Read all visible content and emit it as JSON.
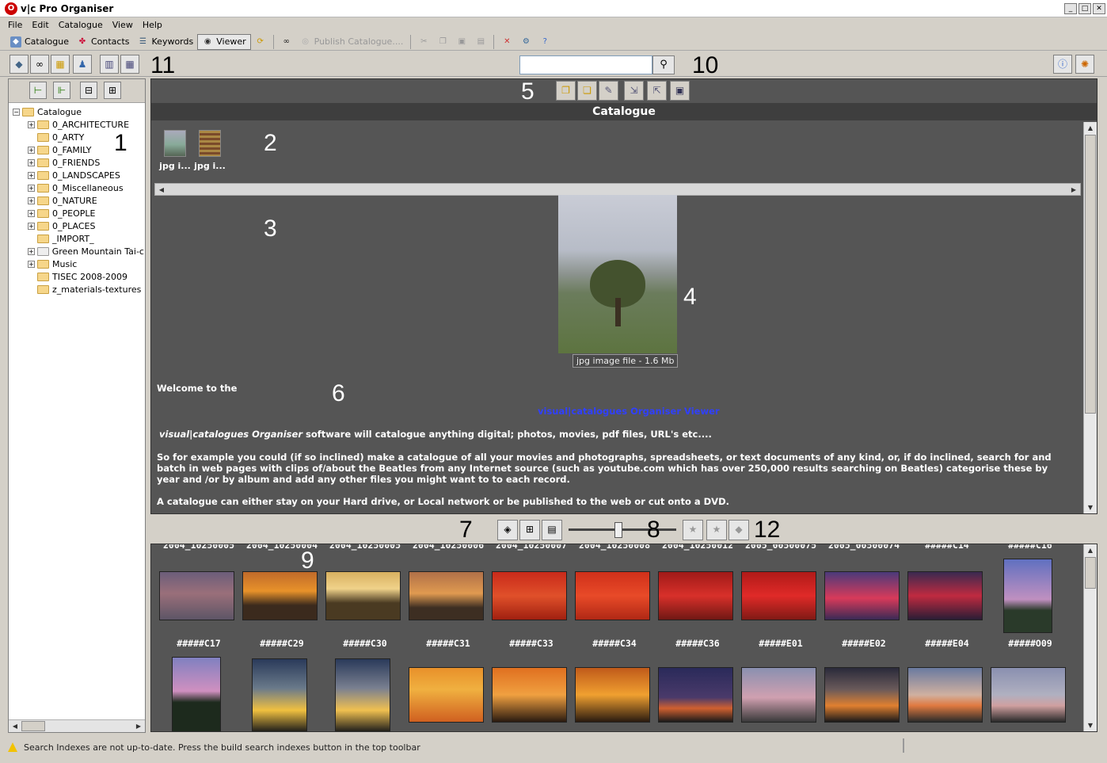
{
  "window": {
    "title": "v|c Pro Organiser",
    "app_icon": "O"
  },
  "menu": [
    "File",
    "Edit",
    "Catalogue",
    "View",
    "Help"
  ],
  "toolbar": {
    "catalogue": "Catalogue",
    "contacts": "Contacts",
    "keywords": "Keywords",
    "viewer": "Viewer",
    "publish": "Publish Catalogue...."
  },
  "annotations": [
    "1",
    "2",
    "3",
    "4",
    "5",
    "6",
    "7",
    "8",
    "9",
    "10",
    "11",
    "12"
  ],
  "tree": {
    "root": "Catalogue",
    "items": [
      {
        "label": "0_ARCHITECTURE",
        "expandable": true
      },
      {
        "label": "0_ARTY",
        "expandable": false
      },
      {
        "label": "0_FAMILY",
        "expandable": true
      },
      {
        "label": "0_FRIENDS",
        "expandable": true
      },
      {
        "label": "0_LANDSCAPES",
        "expandable": true
      },
      {
        "label": "0_Miscellaneous",
        "expandable": true
      },
      {
        "label": "0_NATURE",
        "expandable": true
      },
      {
        "label": "0_PEOPLE",
        "expandable": true
      },
      {
        "label": "0_PLACES",
        "expandable": true
      },
      {
        "label": "_IMPORT_",
        "expandable": false
      },
      {
        "label": "Green Mountain Tai-chi",
        "expandable": true
      },
      {
        "label": "Music",
        "expandable": true
      },
      {
        "label": "TISEC 2008-2009",
        "expandable": false
      },
      {
        "label": "z_materials-textures",
        "expandable": false
      }
    ]
  },
  "viewer": {
    "title": "Catalogue",
    "thumbs": [
      "jpg i...",
      "jpg i..."
    ],
    "caption": "jpg image file - 1.6 Mb",
    "welcome": "Welcome to the",
    "link": "visual|catalogues Organiser Viewer",
    "para1_em": "visual|catalogues Organiser",
    "para1_rest": " software will catalogue anything digital; photos, movies, pdf  files, URL's etc....",
    "para2": "So for example you could (if so inclined) make a catalogue of all your movies and photographs, spreadsheets, or text documents of any kind, or, if do inclined, search for and batch in web pages with clips of/about the Beatles from any Internet source (such as youtube.com which has over 250,000 results searching on Beatles)  categorise these by year and /or by album and add any other files you might want to to each record.",
    "para3": "A catalogue can either stay on your Hard drive, or Local network or be published to the web or cut onto a DVD."
  },
  "gallery": {
    "top_labels": [
      "2004_10250005",
      "2004_10250004",
      "2004_10250005",
      "2004_10250006",
      "2004_10250007",
      "2004_10250008",
      "2004_10250012",
      "2005_00500075",
      "2005_00500074",
      "#####C14",
      "#####C16"
    ],
    "row1": [
      "#####C17",
      "#####C29",
      "#####C30",
      "#####C31",
      "#####C33",
      "#####C34",
      "#####C36",
      "#####E01",
      "#####E02",
      "#####E04",
      "#####O09"
    ]
  },
  "status": {
    "message": "Search Indexes are not up-to-date. Press the build search indexes button in the top toolbar"
  }
}
